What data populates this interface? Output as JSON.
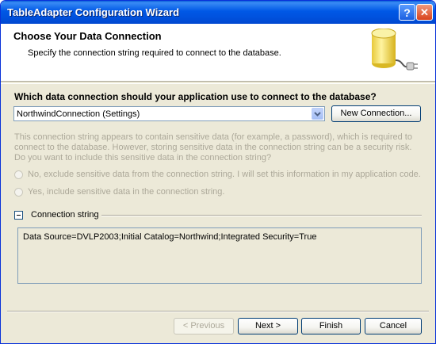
{
  "window": {
    "title": "TableAdapter Configuration Wizard",
    "help_label": "?",
    "close_label": "✕"
  },
  "header": {
    "title": "Choose Your Data Connection",
    "subtitle": "Specify the connection string required to connect to the database."
  },
  "connection": {
    "question": "Which data connection should your application use to connect to the database?",
    "selected": "NorthwindConnection (Settings)",
    "new_button": "New Connection..."
  },
  "sensitive": {
    "warning": "This connection string appears to contain sensitive data (for example, a password), which is required to connect to the database. However, storing sensitive data in the connection string can be a security risk. Do you want to include this sensitive data in the connection string?",
    "option_no": "No, exclude sensitive data from the connection string. I will set this information in my application code.",
    "option_yes": "Yes, include sensitive data in the connection string."
  },
  "connection_string": {
    "label": "Connection string",
    "value": "Data Source=DVLP2003;Initial Catalog=Northwind;Integrated Security=True"
  },
  "buttons": {
    "previous": "< Previous",
    "next": "Next >",
    "finish": "Finish",
    "cancel": "Cancel"
  },
  "colors": {
    "titlebar": "#0058e6",
    "dialog_bg": "#ece9d8",
    "disabled_text": "#aca899"
  }
}
